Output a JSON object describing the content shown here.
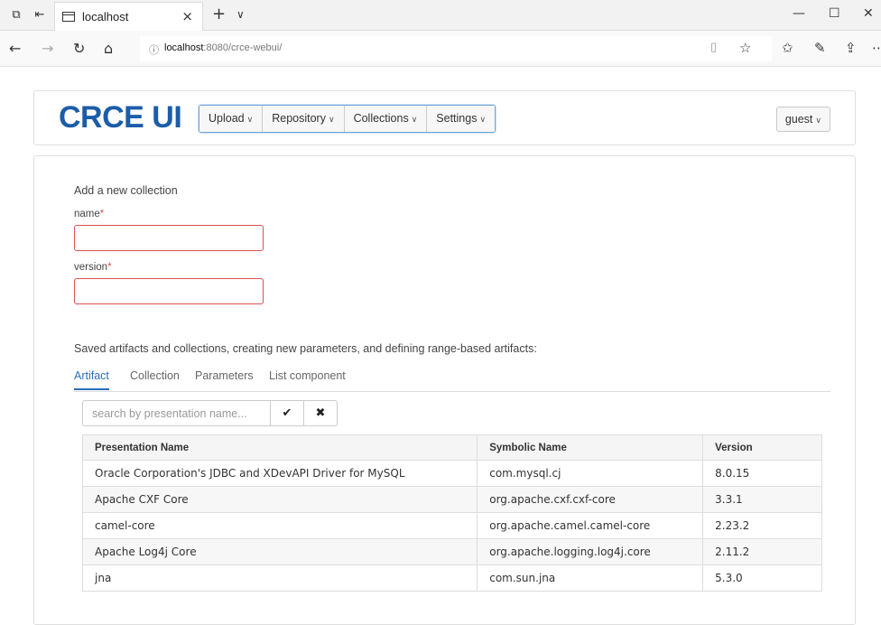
{
  "browser": {
    "tab_title": "localhost",
    "url_host": "localhost",
    "url_path": ":8080/crce-webui/"
  },
  "header": {
    "logo": "CRCE UI",
    "nav": [
      {
        "label": "Upload"
      },
      {
        "label": "Repository"
      },
      {
        "label": "Collections"
      },
      {
        "label": "Settings"
      }
    ],
    "user": "guest"
  },
  "form": {
    "title": "Add a new collection",
    "name_label": "name",
    "version_label": "version",
    "required_mark": "*"
  },
  "saved": {
    "note": "Saved artifacts and collections, creating new parameters, and defining range-based artifacts:",
    "tabs": [
      "Artifact",
      "Collection",
      "Parameters",
      "List component"
    ],
    "active_tab": "Artifact",
    "search_placeholder": "search by presentation name..."
  },
  "table": {
    "headers": [
      "Presentation Name",
      "Symbolic Name",
      "Version"
    ],
    "rows": [
      [
        "Oracle Corporation's JDBC and XDevAPI Driver for MySQL",
        "com.mysql.cj",
        "8.0.15"
      ],
      [
        "Apache CXF Core",
        "org.apache.cxf.cxf-core",
        "3.3.1"
      ],
      [
        "camel-core",
        "org.apache.camel.camel-core",
        "2.23.2"
      ],
      [
        "Apache Log4j Core",
        "org.apache.logging.log4j.core",
        "2.11.2"
      ],
      [
        "jna",
        "com.sun.jna",
        "5.3.0"
      ]
    ]
  },
  "colors": {
    "brand": "#1c5da8",
    "accent": "#2a6ebb",
    "error": "#d9534f"
  }
}
